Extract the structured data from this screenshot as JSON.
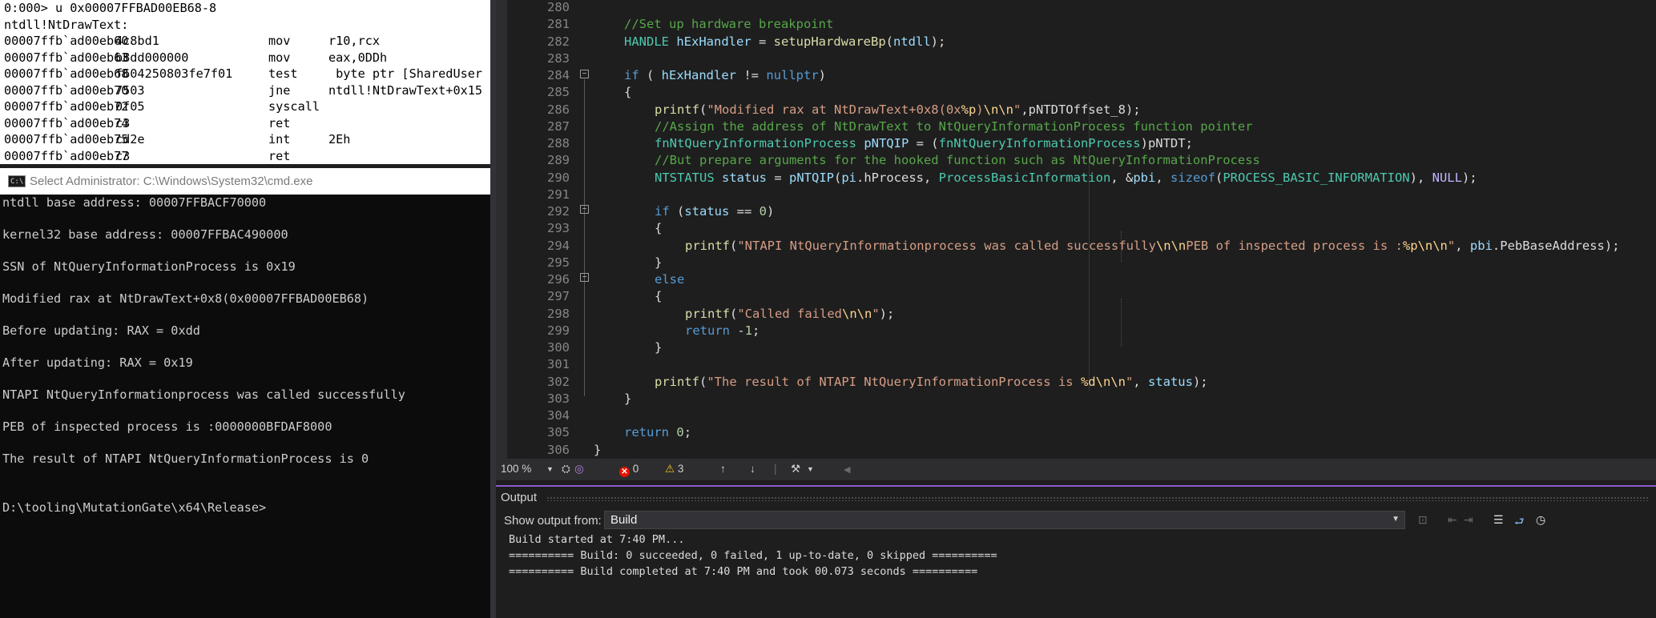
{
  "debugger": {
    "command": "0:000> u 0x00007FFBAD00EB68-8",
    "symbol": "ntdll!NtDrawText:",
    "rows": [
      {
        "addr": "00007ffb`ad00eb60",
        "bytes": "4c8bd1",
        "mnem": "mov",
        "ops": "r10,rcx"
      },
      {
        "addr": "00007ffb`ad00eb63",
        "bytes": "b8dd000000",
        "mnem": "mov",
        "ops": "eax,0DDh"
      },
      {
        "addr": "00007ffb`ad00eb68",
        "bytes": "f604250803fe7f01",
        "mnem": "test",
        "ops": " byte ptr [SharedUser"
      },
      {
        "addr": "00007ffb`ad00eb70",
        "bytes": "7503",
        "mnem": "jne",
        "ops": "ntdll!NtDrawText+0x15"
      },
      {
        "addr": "00007ffb`ad00eb72",
        "bytes": "0f05",
        "mnem": "syscall",
        "ops": ""
      },
      {
        "addr": "00007ffb`ad00eb74",
        "bytes": "c3",
        "mnem": "ret",
        "ops": ""
      },
      {
        "addr": "00007ffb`ad00eb75",
        "bytes": "cd2e",
        "mnem": "int",
        "ops": "2Eh"
      },
      {
        "addr": "00007ffb`ad00eb77",
        "bytes": "c3",
        "mnem": "ret",
        "ops": ""
      }
    ]
  },
  "cmd": {
    "icon_text": "C:\\.",
    "title": "Select Administrator: C:\\Windows\\System32\\cmd.exe",
    "lines": [
      "ntdll base address: 00007FFBACF70000",
      "kernel32 base address: 00007FFBAC490000",
      "SSN of NtQueryInformationProcess is 0x19",
      "Modified rax at NtDrawText+0x8(0x00007FFBAD00EB68)",
      "Before updating: RAX = 0xdd",
      "After updating: RAX = 0x19",
      "NTAPI NtQueryInformationprocess was called successfully",
      "PEB of inspected process is :0000000BFDAF8000",
      "The result of NTAPI NtQueryInformationProcess is 0",
      "D:\\tooling\\MutationGate\\x64\\Release>"
    ]
  },
  "editor": {
    "line_numbers": [
      "280",
      "281",
      "282",
      "283",
      "284",
      "285",
      "286",
      "287",
      "288",
      "289",
      "290",
      "291",
      "292",
      "293",
      "294",
      "295",
      "296",
      "297",
      "298",
      "299",
      "300",
      "301",
      "302",
      "303",
      "304",
      "305",
      "306"
    ],
    "code": [
      [],
      [
        {
          "t": "//Set up hardware breakpoint",
          "c": "comment"
        }
      ],
      [
        {
          "t": "HANDLE",
          "c": "type"
        },
        {
          "t": " ",
          "c": "plain"
        },
        {
          "t": "hExHandler",
          "c": "var"
        },
        {
          "t": " = ",
          "c": "plain"
        },
        {
          "t": "setupHardwareBp",
          "c": "fn"
        },
        {
          "t": "(",
          "c": "plain"
        },
        {
          "t": "ntdll",
          "c": "var"
        },
        {
          "t": ");",
          "c": "plain"
        }
      ],
      [],
      [
        {
          "t": "if",
          "c": "kw"
        },
        {
          "t": " ( ",
          "c": "plain"
        },
        {
          "t": "hExHandler",
          "c": "var"
        },
        {
          "t": " != ",
          "c": "plain"
        },
        {
          "t": "nullptr",
          "c": "kw"
        },
        {
          "t": ")",
          "c": "plain"
        }
      ],
      [
        {
          "t": "{",
          "c": "plain"
        }
      ],
      [
        {
          "t": "printf",
          "c": "fn"
        },
        {
          "t": "(",
          "c": "plain"
        },
        {
          "t": "\"Modified rax at NtDrawText+0x8(0x",
          "c": "str"
        },
        {
          "t": "%p",
          "c": "esc"
        },
        {
          "t": ")",
          "c": "str"
        },
        {
          "t": "\\n\\n",
          "c": "esc"
        },
        {
          "t": "\"",
          "c": "str"
        },
        {
          "t": ",pNTDTOffset_8);",
          "c": "plain"
        }
      ],
      [
        {
          "t": "//Assign the address of NtDrawText to NtQueryInformationProcess function pointer",
          "c": "comment"
        }
      ],
      [
        {
          "t": "fnNtQueryInformationProcess",
          "c": "type"
        },
        {
          "t": " ",
          "c": "plain"
        },
        {
          "t": "pNTQIP",
          "c": "var"
        },
        {
          "t": " = (",
          "c": "plain"
        },
        {
          "t": "fnNtQueryInformationProcess",
          "c": "type"
        },
        {
          "t": ")pNTDT;",
          "c": "plain"
        }
      ],
      [
        {
          "t": "//But prepare arguments for the hooked function such as NtQueryInformationProcess",
          "c": "comment"
        }
      ],
      [
        {
          "t": "NTSTATUS",
          "c": "type"
        },
        {
          "t": " ",
          "c": "plain"
        },
        {
          "t": "status",
          "c": "var"
        },
        {
          "t": " = ",
          "c": "plain"
        },
        {
          "t": "pNTQIP",
          "c": "var"
        },
        {
          "t": "(",
          "c": "plain"
        },
        {
          "t": "pi",
          "c": "var"
        },
        {
          "t": ".hProcess, ",
          "c": "plain"
        },
        {
          "t": "ProcessBasicInformation",
          "c": "type"
        },
        {
          "t": ", &",
          "c": "plain"
        },
        {
          "t": "pbi",
          "c": "var"
        },
        {
          "t": ", ",
          "c": "plain"
        },
        {
          "t": "sizeof",
          "c": "kw"
        },
        {
          "t": "(",
          "c": "plain"
        },
        {
          "t": "PROCESS_BASIC_INFORMATION",
          "c": "type"
        },
        {
          "t": "), ",
          "c": "plain"
        },
        {
          "t": "NULL",
          "c": "macro"
        },
        {
          "t": ");",
          "c": "plain"
        }
      ],
      [],
      [
        {
          "t": "if",
          "c": "kw"
        },
        {
          "t": " (",
          "c": "plain"
        },
        {
          "t": "status",
          "c": "var"
        },
        {
          "t": " == ",
          "c": "plain"
        },
        {
          "t": "0",
          "c": "num"
        },
        {
          "t": ")",
          "c": "plain"
        }
      ],
      [
        {
          "t": "{",
          "c": "plain"
        }
      ],
      [
        {
          "t": "printf",
          "c": "fn"
        },
        {
          "t": "(",
          "c": "plain"
        },
        {
          "t": "\"NTAPI NtQueryInformationprocess was called successfully",
          "c": "str"
        },
        {
          "t": "\\n\\n",
          "c": "esc"
        },
        {
          "t": "PEB of inspected process is :",
          "c": "str"
        },
        {
          "t": "%p",
          "c": "esc"
        },
        {
          "t": "\\n\\n",
          "c": "esc"
        },
        {
          "t": "\"",
          "c": "str"
        },
        {
          "t": ", ",
          "c": "plain"
        },
        {
          "t": "pbi",
          "c": "var"
        },
        {
          "t": ".PebBaseAddress);",
          "c": "plain"
        }
      ],
      [
        {
          "t": "}",
          "c": "plain"
        }
      ],
      [
        {
          "t": "else",
          "c": "kw"
        }
      ],
      [
        {
          "t": "{",
          "c": "plain"
        }
      ],
      [
        {
          "t": "printf",
          "c": "fn"
        },
        {
          "t": "(",
          "c": "plain"
        },
        {
          "t": "\"Called failed",
          "c": "str"
        },
        {
          "t": "\\n\\n",
          "c": "esc"
        },
        {
          "t": "\"",
          "c": "str"
        },
        {
          "t": ");",
          "c": "plain"
        }
      ],
      [
        {
          "t": "return",
          "c": "kw"
        },
        {
          "t": " -",
          "c": "plain"
        },
        {
          "t": "1",
          "c": "num"
        },
        {
          "t": ";",
          "c": "plain"
        }
      ],
      [
        {
          "t": "}",
          "c": "plain"
        }
      ],
      [],
      [
        {
          "t": "printf",
          "c": "fn"
        },
        {
          "t": "(",
          "c": "plain"
        },
        {
          "t": "\"The result of NTAPI NtQueryInformationProcess is ",
          "c": "str"
        },
        {
          "t": "%d",
          "c": "esc"
        },
        {
          "t": "\\n\\n",
          "c": "esc"
        },
        {
          "t": "\"",
          "c": "str"
        },
        {
          "t": ", ",
          "c": "plain"
        },
        {
          "t": "status",
          "c": "var"
        },
        {
          "t": ");",
          "c": "plain"
        }
      ],
      [
        {
          "t": "}",
          "c": "plain"
        }
      ],
      [],
      [
        {
          "t": "return",
          "c": "kw"
        },
        {
          "t": " ",
          "c": "plain"
        },
        {
          "t": "0",
          "c": "num"
        },
        {
          "t": ";",
          "c": "plain"
        }
      ],
      [
        {
          "t": "}",
          "c": "plain"
        }
      ]
    ]
  },
  "status": {
    "zoom": "100 %",
    "errors": "0",
    "warnings": "3"
  },
  "output": {
    "title": "Output",
    "show_from_label": "Show output from:",
    "show_from_value": "Build",
    "lines": [
      "Build started at 7:40 PM...",
      "========== Build: 0 succeeded, 0 failed, 1 up-to-date, 0 skipped ==========",
      "========== Build completed at 7:40 PM and took 00.073 seconds =========="
    ]
  },
  "colors": {
    "accent": "#8a5ccc",
    "error": "#e51400",
    "warning": "#f0c020"
  }
}
